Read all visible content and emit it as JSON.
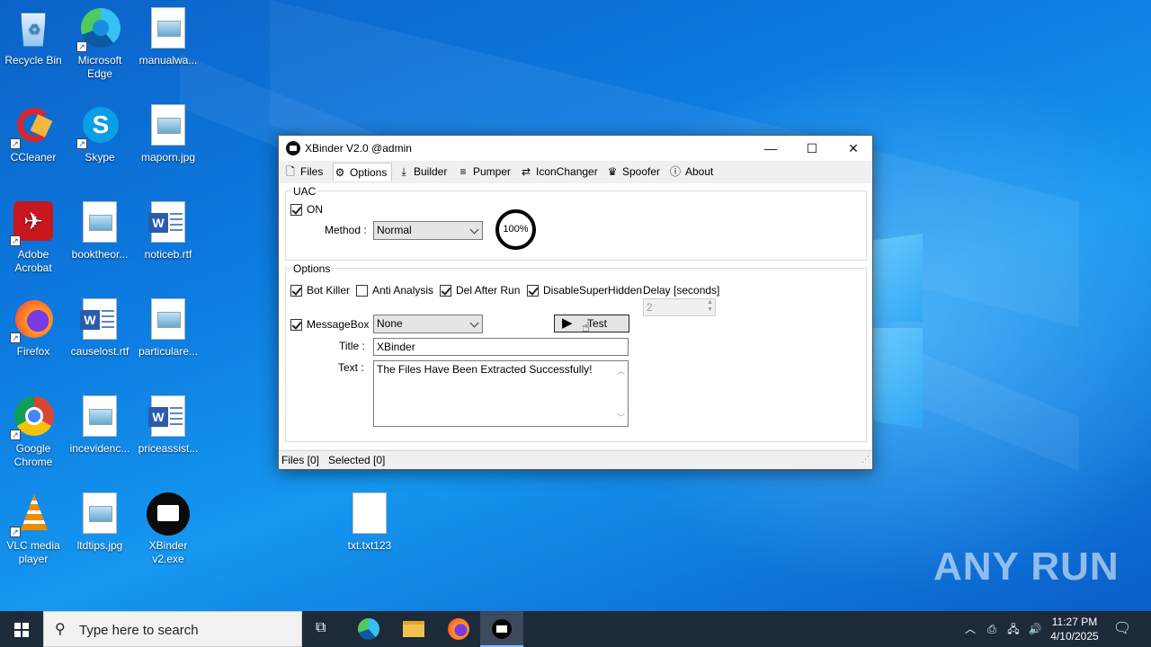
{
  "desktop": {
    "icons": [
      {
        "label": "Recycle Bin"
      },
      {
        "label": "Microsoft Edge"
      },
      {
        "label": "manualwa..."
      },
      {
        "label": "CCleaner"
      },
      {
        "label": "Skype"
      },
      {
        "label": "maporn.jpg"
      },
      {
        "label": "Adobe Acrobat"
      },
      {
        "label": "booktheor..."
      },
      {
        "label": "noticeb.rtf"
      },
      {
        "label": "Firefox"
      },
      {
        "label": "causelost.rtf"
      },
      {
        "label": "particulare..."
      },
      {
        "label": "Google Chrome"
      },
      {
        "label": "incevidenc..."
      },
      {
        "label": "priceassist..."
      },
      {
        "label": "VLC media player"
      },
      {
        "label": "ltdtips.jpg"
      },
      {
        "label": "XBinder v2.exe"
      },
      {
        "label": "txt.txt123"
      }
    ],
    "watermark": "ANY RUN"
  },
  "window": {
    "title": "XBinder V2.0 @admin",
    "controls": {
      "minimize": "—",
      "maximize": "☐",
      "close": "✕"
    },
    "menu": [
      {
        "label": "Files",
        "icon": "file-icon"
      },
      {
        "label": "Options",
        "icon": "gear-icon",
        "active": true
      },
      {
        "label": "Builder",
        "icon": "download-icon"
      },
      {
        "label": "Pumper",
        "icon": "lines-icon"
      },
      {
        "label": "IconChanger",
        "icon": "swap-icon"
      },
      {
        "label": "Spoofer",
        "icon": "spoofer-icon"
      },
      {
        "label": "About",
        "icon": "info-icon"
      }
    ],
    "uac": {
      "group_title": "UAC",
      "on_label": "ON",
      "on_checked": true,
      "method_label": "Method :",
      "method_value": "Normal",
      "percent": "100%"
    },
    "options": {
      "group_title": "Options",
      "checks": [
        {
          "label": "Bot Killer",
          "checked": true
        },
        {
          "label": "Anti Analysis",
          "checked": false
        },
        {
          "label": "Del After Run",
          "checked": true
        },
        {
          "label": "DisableSuperHidden",
          "checked": true
        }
      ],
      "delay_label": "Delay [seconds]",
      "delay_value": "2",
      "messagebox_label": "MessageBox",
      "messagebox_checked": true,
      "messagebox_type": "None",
      "test_label": "Test",
      "title_label": "Title :",
      "title_value": "XBinder",
      "text_label": "Text :",
      "text_value": "The Files Have Been Extracted Successfully!"
    },
    "status": "Files [0]   Selected [0]"
  },
  "taskbar": {
    "search_placeholder": "Type here to search",
    "time": "11:27 PM",
    "date": "4/10/2025"
  }
}
